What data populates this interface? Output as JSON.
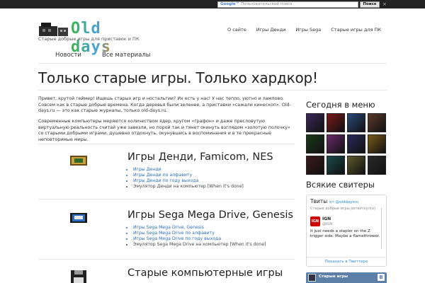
{
  "topbar": {
    "search_brand": "Google™",
    "search_placeholder": "Пользовательский поиск",
    "search_button": "Поиск",
    "close_glyph": "×"
  },
  "logo": {
    "title": "Old days",
    "tagline": "Старые добрые игры для приставок и ПК"
  },
  "header_nav": [
    "О сайте",
    "Игры Денди",
    "Игры Sega",
    "Старые игры для ПК"
  ],
  "subnav": [
    "Новости",
    "Все материалы"
  ],
  "page_title": "Только старые игры. Только хардкор!",
  "intro": [
    "Привет, крутой геймер! Ищешь старых игр и ностальгии? Их есть у нас! У нас тепло, уютно и лампово. Совсем как в старые добрые времена. Когда деревья были зеленее, а приставки «сажали кинескоп». Old-days.ru — это как старые журналы, только old-days.ru.",
    "Современные компьютеры меряются количеством ядер, кругом «графон» и даже пресловутую виртуальную реальность считай уже завезли, но порой так и тянет окинуть взглядом «золотую полочку» со старыми добрыми играми, душевно отдохнуть, окунувшись в воспоминания и в те прекрасные неповторимые миры."
  ],
  "sections": [
    {
      "title": "Игры Денди, Famicom, NES",
      "icon": "nes-cartridge-icon",
      "links": [
        "Игры Денди",
        "Игры Денди по алфавиту",
        "Игры Денди по году выхода"
      ],
      "plain": [
        "Эмулятор Денди на компьютер [When it's done]"
      ]
    },
    {
      "title": "Игры Sega Mega Drive, Genesis",
      "icon": "sega-cartridge-icon",
      "links": [
        "Игры Sega Mega Drive, Genesis",
        "Игры Sega Mega Drive по алфавиту",
        "Игры Sega Mega Drive по году выхода"
      ],
      "plain": [
        "Эмулятор Sega Mega Drive на компьютер [When it's done]"
      ]
    },
    {
      "title": "Старые компьютерные игры",
      "icon": "floppy-disk-icon",
      "links": [],
      "plain": []
    }
  ],
  "sidebar": {
    "menu_title": "Сегодня в меню",
    "thumb_colors": [
      "#3a2a5a",
      "#7a1a1a",
      "#2a4a7a",
      "#5a3a2a",
      "#1a3a1a",
      "#6a2a6a",
      "#2a2a5a",
      "#7a5a1a",
      "#3a1a1a",
      "#1a4a4a",
      "#5a5a2a",
      "#2a2a2a"
    ],
    "sweaters_title": "Всякие свитеры",
    "twitter": {
      "title": "Твиты",
      "handle": "от @olddaysru",
      "retweet_note": "Старые добрые игры ретвитнул(а)",
      "author": "IGN",
      "author_handle": "@IGN",
      "text": "It just needs a stapler on the Z trigger side. Maybe a flamethrower.",
      "footer": "Показать в Твиттере"
    },
    "vk": {
      "group": "Старые игры",
      "logo": "В"
    }
  },
  "colors": {
    "link": "#2a6ebb",
    "topbar": "#232323",
    "vk": "#5b7fa6"
  }
}
